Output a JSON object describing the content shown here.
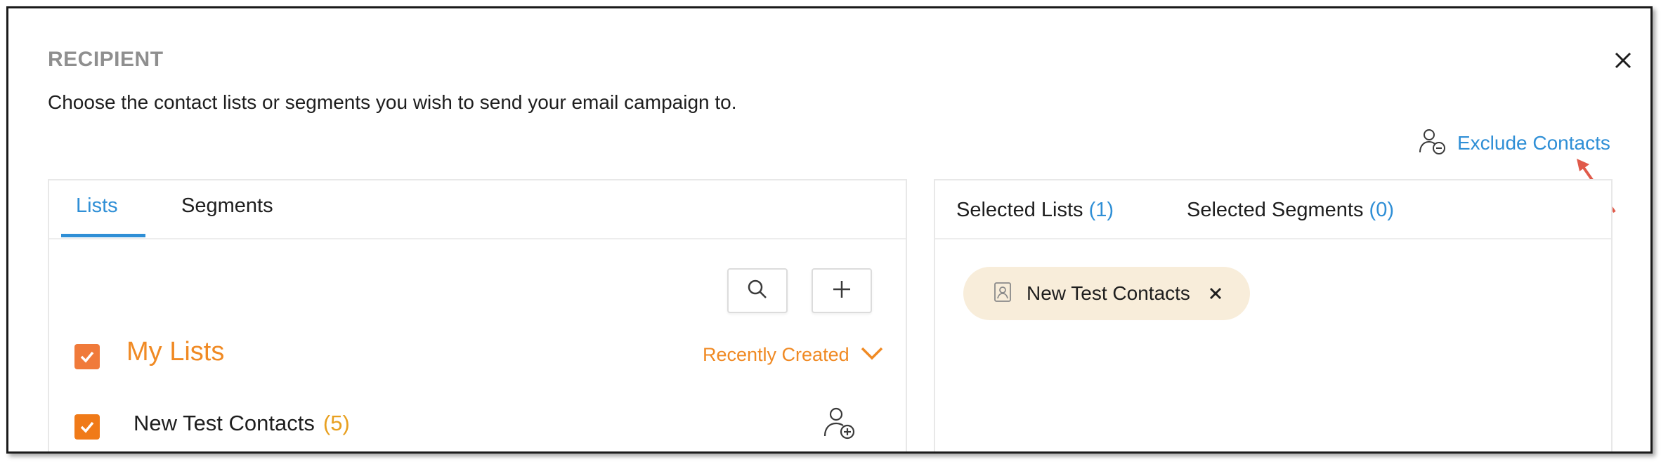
{
  "dialog": {
    "title": "RECIPIENT",
    "description": "Choose the contact lists or segments you wish to send your email campaign to.",
    "close_icon": "close-icon"
  },
  "exclude": {
    "label": "Exclude Contacts",
    "icon": "user-minus-icon"
  },
  "left_panel": {
    "tabs": [
      {
        "label": "Lists",
        "active": true
      },
      {
        "label": "Segments",
        "active": false
      }
    ],
    "actions": {
      "search_icon": "search-icon",
      "add_icon": "plus-icon"
    },
    "group": {
      "title": "My Lists",
      "checked": true,
      "sort_label": "Recently Created",
      "sort_icon": "chevron-down-icon"
    },
    "items": [
      {
        "name": "New Test Contacts",
        "count": "(5)",
        "checked": true,
        "action_icon": "add-user-icon"
      }
    ]
  },
  "right_panel": {
    "tabs": [
      {
        "label": "Selected Lists",
        "count": "(1)"
      },
      {
        "label": "Selected Segments",
        "count": "(0)"
      }
    ],
    "chips": [
      {
        "label": "New Test Contacts",
        "icon": "contact-list-icon"
      }
    ]
  },
  "colors": {
    "accent_blue": "#2f8fd6",
    "accent_orange": "#f08a24",
    "checkbox_orange": "#f07a3a",
    "count_orange": "#e8a020",
    "chip_bg": "#f8edda",
    "arrow_red": "#e05a4a"
  }
}
